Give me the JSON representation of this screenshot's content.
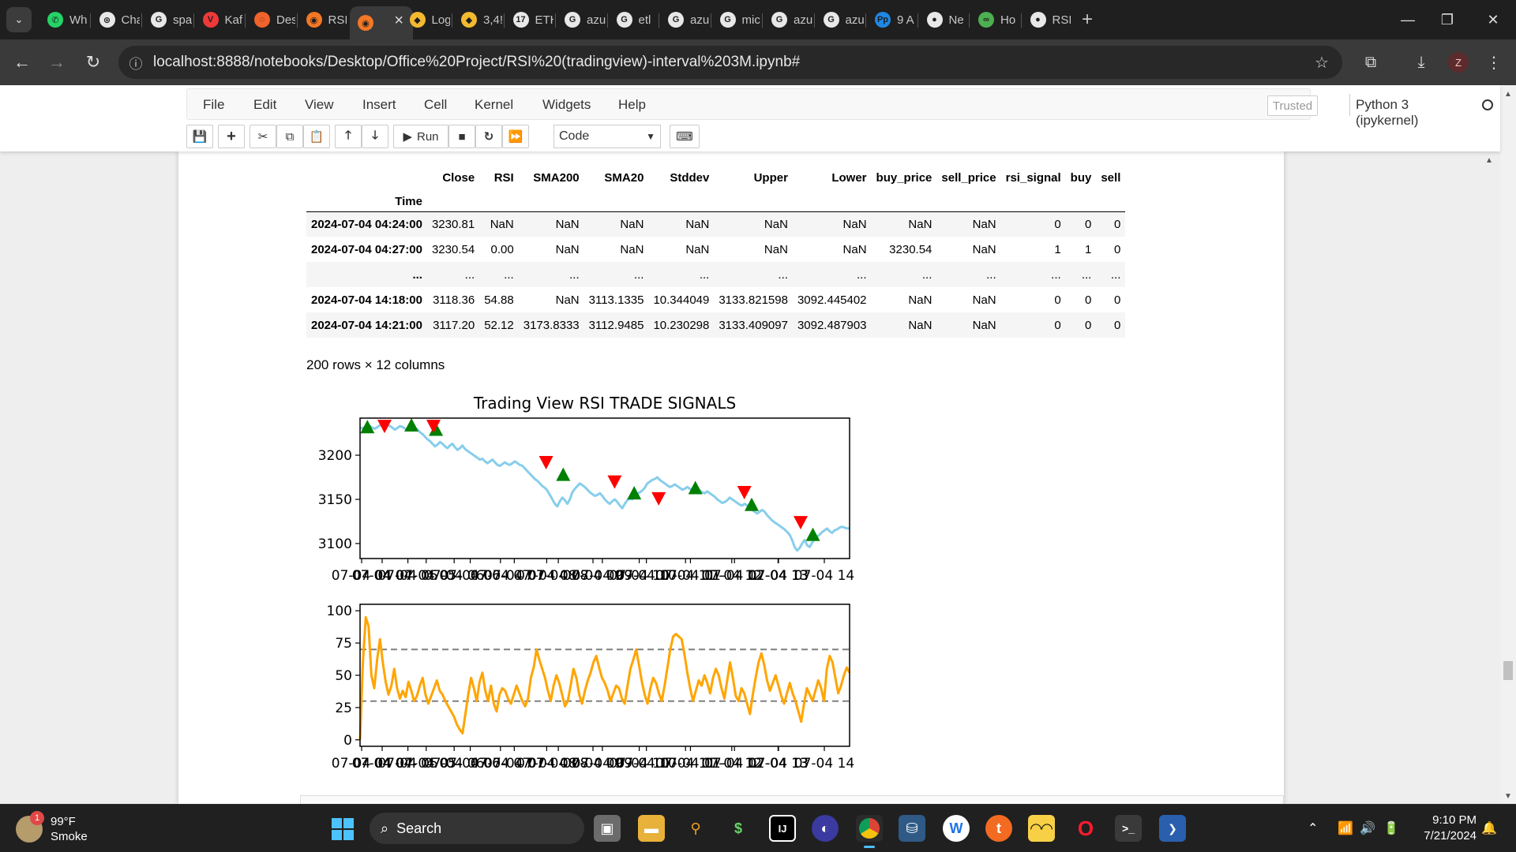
{
  "browser": {
    "tabs": [
      {
        "label": "Wh",
        "icon": "whatsapp-icon",
        "color": "#25d366"
      },
      {
        "label": "Cha",
        "icon": "chatgpt-icon",
        "color": "#e8e8e8"
      },
      {
        "label": "spa",
        "icon": "google-icon",
        "color": "#e8e8e8"
      },
      {
        "label": "Kaf",
        "icon": "vivaldi-icon",
        "color": "#ef3939"
      },
      {
        "label": "Des",
        "icon": "loader-icon",
        "color": "#f0632a"
      },
      {
        "label": "RSI",
        "icon": "jupyter-icon",
        "color": "#f37726"
      },
      {
        "label": "",
        "icon": "jupyter-icon",
        "color": "#f37726"
      },
      {
        "label": "Log",
        "icon": "binance-icon",
        "color": "#f3ba2f"
      },
      {
        "label": "3,4!",
        "icon": "binance-icon",
        "color": "#f3ba2f"
      },
      {
        "label": "ETH",
        "icon": "tradingview-icon",
        "color": "#e8e8e8"
      },
      {
        "label": "azu",
        "icon": "google-icon",
        "color": "#e8e8e8"
      },
      {
        "label": "etl",
        "icon": "google-icon",
        "color": "#e8e8e8"
      },
      {
        "label": "azu",
        "icon": "google-icon",
        "color": "#e8e8e8"
      },
      {
        "label": "mic",
        "icon": "google-icon",
        "color": "#e8e8e8"
      },
      {
        "label": "azu",
        "icon": "google-icon",
        "color": "#e8e8e8"
      },
      {
        "label": "azu",
        "icon": "google-icon",
        "color": "#e8e8e8"
      },
      {
        "label": "9 A",
        "icon": "pp-icon",
        "color": "#1e88e5"
      },
      {
        "label": "Ne",
        "icon": "github-icon",
        "color": "#e8e8e8"
      },
      {
        "label": "Ho",
        "icon": "infinity-icon",
        "color": "#4caf50"
      },
      {
        "label": "RSI",
        "icon": "github-icon",
        "color": "#e8e8e8"
      }
    ],
    "active_tab_index": 6,
    "new_tab": "+",
    "url": "localhost:8888/notebooks/Desktop/Office%20Project/RSI%20(tradingview)-interval%203M.ipynb#",
    "profile_initial": "Z"
  },
  "jupyter": {
    "menus": [
      "File",
      "Edit",
      "View",
      "Insert",
      "Cell",
      "Kernel",
      "Widgets",
      "Help"
    ],
    "trusted": "Trusted",
    "kernel": "Python 3 (ipykernel)",
    "run_label": "Run",
    "cell_type": "Code"
  },
  "dataframe": {
    "columns": [
      "Close",
      "RSI",
      "SMA200",
      "SMA20",
      "Stddev",
      "Upper",
      "Lower",
      "buy_price",
      "sell_price",
      "rsi_signal",
      "buy",
      "sell"
    ],
    "index_name": "Time",
    "rows": [
      {
        "index": "2024-07-04 04:24:00",
        "values": [
          "3230.81",
          "NaN",
          "NaN",
          "NaN",
          "NaN",
          "NaN",
          "NaN",
          "NaN",
          "NaN",
          "0",
          "0",
          "0"
        ]
      },
      {
        "index": "2024-07-04 04:27:00",
        "values": [
          "3230.54",
          "0.00",
          "NaN",
          "NaN",
          "NaN",
          "NaN",
          "NaN",
          "3230.54",
          "NaN",
          "1",
          "1",
          "0"
        ]
      },
      {
        "index": "...",
        "values": [
          "...",
          "...",
          "...",
          "...",
          "...",
          "...",
          "...",
          "...",
          "...",
          "...",
          "...",
          "..."
        ]
      },
      {
        "index": "2024-07-04 14:18:00",
        "values": [
          "3118.36",
          "54.88",
          "NaN",
          "3113.1335",
          "10.344049",
          "3133.821598",
          "3092.445402",
          "NaN",
          "NaN",
          "0",
          "0",
          "0"
        ]
      },
      {
        "index": "2024-07-04 14:21:00",
        "values": [
          "3117.20",
          "52.12",
          "3173.8333",
          "3112.9485",
          "10.230298",
          "3133.409097",
          "3092.487903",
          "NaN",
          "NaN",
          "0",
          "0",
          "0"
        ]
      }
    ],
    "shape": "200 rows × 12 columns"
  },
  "chart_data": [
    {
      "type": "line",
      "title": "Trading View RSI TRADE SIGNALS",
      "xlabel": "",
      "ylabel": "",
      "x_tick_labels": [
        "07-04 04",
        "07-04 05",
        "07-04 06",
        "07-04 07",
        "07-04 08",
        "07-04 09",
        "07-04 10",
        "07-04 11",
        "07-04 12",
        "07-04 13",
        "07-04 14"
      ],
      "x_tick_labels_overlaid": [
        "07-04 04",
        "07-04 05",
        "07-04 06",
        "07-04 07",
        "07-04 08",
        "07-04 09",
        "07-04 10",
        "07-04 11",
        "07-04 12",
        "07-04 13"
      ],
      "y_ticks": [
        3100,
        3150,
        3200
      ],
      "xlim": [
        0,
        200
      ],
      "ylim": [
        3083,
        3242
      ],
      "colors": {
        "line": "#87ceeb",
        "buy": "#008000",
        "sell": "#ff0000"
      },
      "series": [
        {
          "values": [
            3230.8,
            3230.5,
            3232,
            3234,
            3233,
            3231,
            3230,
            3232,
            3234,
            3235,
            3236,
            3234,
            3233,
            3231,
            3229,
            3231,
            3233,
            3232,
            3230,
            3229,
            3228,
            3230,
            3231,
            3229,
            3226,
            3224,
            3221,
            3218,
            3216,
            3213,
            3210,
            3212,
            3215,
            3213,
            3210,
            3208,
            3211,
            3213,
            3209,
            3206,
            3208,
            3211,
            3207,
            3205,
            3203,
            3201,
            3199,
            3197,
            3195,
            3196,
            3193,
            3191,
            3193,
            3195,
            3192,
            3189,
            3188,
            3190,
            3192,
            3190,
            3189,
            3191,
            3193,
            3191,
            3189,
            3188,
            3185,
            3182,
            3179,
            3176,
            3173,
            3171,
            3168,
            3165,
            3163,
            3160,
            3155,
            3150,
            3145,
            3142,
            3148,
            3152,
            3149,
            3145,
            3150,
            3158,
            3162,
            3165,
            3168,
            3166,
            3164,
            3161,
            3158,
            3156,
            3154,
            3155,
            3157,
            3154,
            3150,
            3147,
            3145,
            3148,
            3150,
            3147,
            3143,
            3140,
            3145,
            3149,
            3151,
            3150,
            3153,
            3156,
            3158,
            3160,
            3163,
            3168,
            3170,
            3172,
            3173,
            3175,
            3172,
            3170,
            3168,
            3166,
            3164,
            3165,
            3167,
            3165,
            3163,
            3161,
            3162,
            3164,
            3162,
            3161,
            3160,
            3162,
            3160,
            3158,
            3157,
            3159,
            3157,
            3155,
            3153,
            3150,
            3148,
            3146,
            3147,
            3149,
            3152,
            3150,
            3148,
            3146,
            3144,
            3143,
            3145,
            3143,
            3140,
            3138,
            3136,
            3134,
            3136,
            3138,
            3136,
            3132,
            3129,
            3126,
            3124,
            3122,
            3120,
            3118,
            3116,
            3113,
            3110,
            3104,
            3096,
            3092,
            3095,
            3100,
            3104,
            3098,
            3096,
            3101,
            3105,
            3108,
            3110,
            3113,
            3115,
            3117,
            3114,
            3112,
            3115,
            3116,
            3118,
            3119,
            3118,
            3117,
            3117.2
          ]
        }
      ],
      "buy_signals": [
        {
          "x": 3,
          "y": 3232
        },
        {
          "x": 21,
          "y": 3234
        },
        {
          "x": 31,
          "y": 3229
        },
        {
          "x": 83,
          "y": 3178
        },
        {
          "x": 112,
          "y": 3157
        },
        {
          "x": 137,
          "y": 3163
        },
        {
          "x": 160,
          "y": 3144
        },
        {
          "x": 185,
          "y": 3110
        }
      ],
      "sell_signals": [
        {
          "x": 10,
          "y": 3233
        },
        {
          "x": 30,
          "y": 3233
        },
        {
          "x": 76,
          "y": 3192
        },
        {
          "x": 104,
          "y": 3170
        },
        {
          "x": 122,
          "y": 3151
        },
        {
          "x": 157,
          "y": 3158
        },
        {
          "x": 180,
          "y": 3124
        }
      ]
    },
    {
      "type": "line",
      "title": "",
      "xlabel": "",
      "ylabel": "",
      "x_tick_labels": [
        "07-04 04",
        "07-04 05",
        "07-04 06",
        "07-04 07",
        "07-04 08",
        "07-04 09",
        "07-04 10",
        "07-04 11",
        "07-04 12",
        "07-04 13",
        "07-04 14"
      ],
      "x_tick_labels_overlaid": [
        "07-04 04",
        "07-04 05",
        "07-04 06",
        "07-04 07",
        "07-04 08",
        "07-04 09",
        "07-04 10",
        "07-04 11",
        "07-04 12",
        "07-04 13"
      ],
      "y_ticks": [
        0,
        25,
        50,
        75,
        100
      ],
      "xlim": [
        0,
        200
      ],
      "ylim": [
        -5,
        105
      ],
      "hlines": [
        70,
        30
      ],
      "colors": {
        "line": "#ffa500",
        "hline": "#808080"
      },
      "series": [
        {
          "values": [
            0,
            60,
            95,
            88,
            50,
            40,
            62,
            78,
            60,
            45,
            35,
            42,
            55,
            40,
            32,
            38,
            33,
            45,
            38,
            30,
            34,
            42,
            48,
            35,
            28,
            34,
            40,
            46,
            38,
            35,
            30,
            26,
            22,
            18,
            12,
            8,
            5,
            20,
            35,
            48,
            40,
            30,
            45,
            52,
            38,
            30,
            42,
            28,
            22,
            35,
            40,
            38,
            32,
            28,
            35,
            42,
            36,
            30,
            26,
            32,
            48,
            56,
            70,
            62,
            55,
            48,
            38,
            30,
            42,
            50,
            44,
            35,
            26,
            30,
            42,
            55,
            48,
            35,
            28,
            38,
            46,
            52,
            60,
            65,
            56,
            48,
            44,
            38,
            30,
            36,
            42,
            40,
            32,
            28,
            42,
            55,
            62,
            70,
            58,
            45,
            35,
            28,
            40,
            48,
            44,
            36,
            30,
            42,
            56,
            70,
            80,
            82,
            80,
            78,
            66,
            52,
            40,
            30,
            38,
            46,
            42,
            50,
            44,
            36,
            48,
            55,
            50,
            40,
            32,
            46,
            60,
            48,
            34,
            30,
            40,
            36,
            28,
            20,
            35,
            48,
            60,
            67,
            58,
            46,
            38,
            44,
            50,
            42,
            34,
            28,
            36,
            44,
            36,
            30,
            22,
            14,
            28,
            40,
            35,
            30,
            38,
            46,
            40,
            30,
            55,
            65,
            60,
            48,
            36,
            42,
            50,
            56,
            52
          ]
        }
      ]
    }
  ],
  "taskbar": {
    "weather_temp": "99°F",
    "weather_desc": "Smoke",
    "weather_badge": "1",
    "search": "Search",
    "time": "9:10 PM",
    "date": "7/21/2024"
  }
}
